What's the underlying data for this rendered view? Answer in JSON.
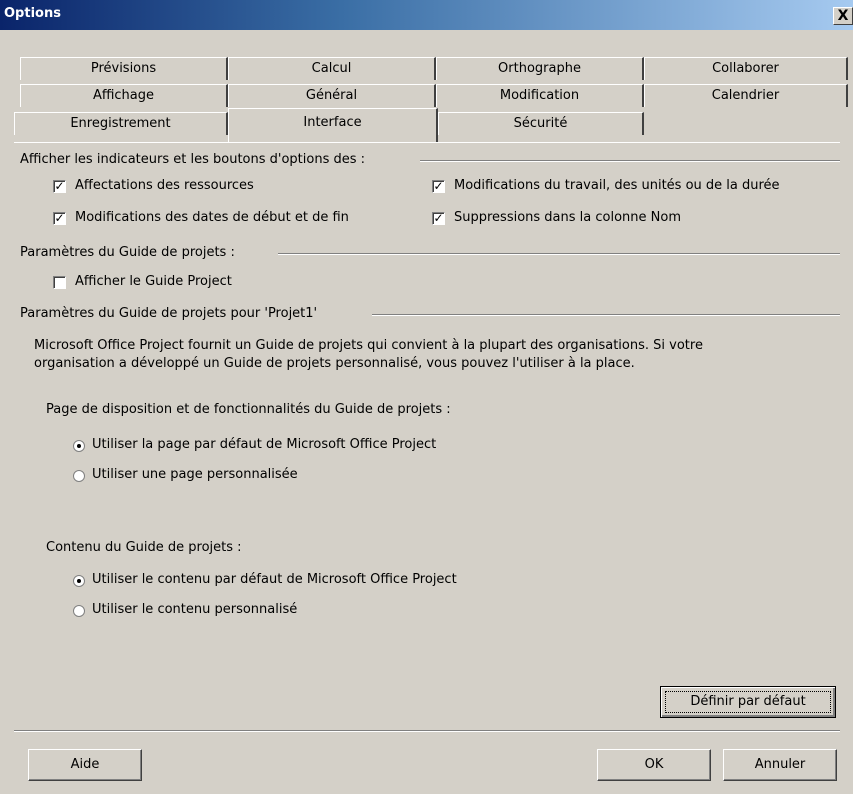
{
  "window": {
    "title": "Options",
    "close_glyph": "X"
  },
  "tabs": {
    "row1": [
      "Prévisions",
      "Calcul",
      "Orthographe",
      "Collaborer"
    ],
    "row2": [
      "Affichage",
      "Général",
      "Modification",
      "Calendrier"
    ],
    "row3": [
      "Enregistrement",
      "Interface",
      "Sécurité"
    ],
    "active": "Interface"
  },
  "indicators": {
    "heading": "Afficher les indicateurs et les boutons d'options des :",
    "items": [
      {
        "label": "Affectations des ressources",
        "checked": true
      },
      {
        "label": "Modifications des dates de début et de fin",
        "checked": true
      },
      {
        "label": "Modifications du travail, des unités ou de la durée",
        "checked": true
      },
      {
        "label": "Suppressions dans la colonne Nom",
        "checked": true
      }
    ]
  },
  "guide": {
    "heading": "Paramètres du Guide de projets :",
    "show_label": "Afficher le Guide Project",
    "show_checked": false
  },
  "project_guide": {
    "heading": "Paramètres du Guide de projets pour 'Projet1'",
    "description_line1": "Microsoft Office Project fournit un Guide de projets qui convient à la plupart des organisations. Si votre",
    "description_line2": "organisation a développé un Guide de projets personnalisé, vous pouvez l'utiliser à la place.",
    "layout_heading": "Page de disposition et de fonctionnalités du Guide de projets :",
    "layout_options": [
      {
        "label": "Utiliser la page par défaut de Microsoft Office Project",
        "selected": true
      },
      {
        "label": "Utiliser une page personnalisée",
        "selected": false
      }
    ],
    "content_heading": "Contenu du Guide de projets :",
    "content_options": [
      {
        "label": "Utiliser le contenu par défaut de Microsoft Office Project",
        "selected": true
      },
      {
        "label": "Utiliser le contenu personnalisé",
        "selected": false
      }
    ],
    "set_default_label": "Définir par défaut"
  },
  "footer": {
    "help_label": "Aide",
    "ok_label": "OK",
    "cancel_label": "Annuler"
  }
}
